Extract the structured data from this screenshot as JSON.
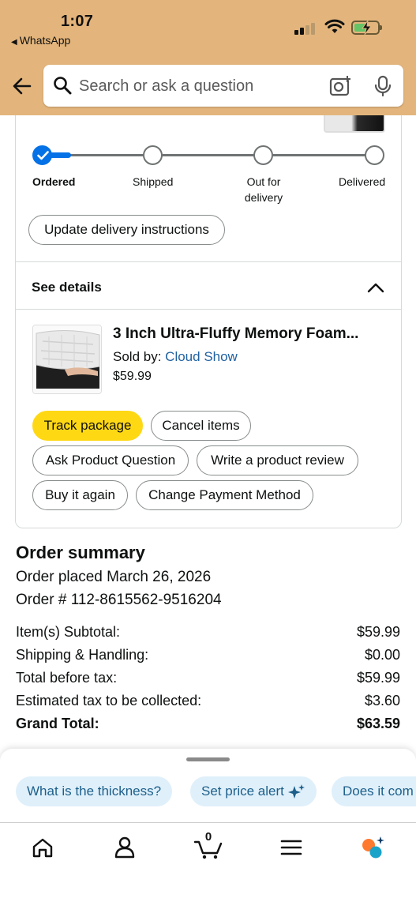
{
  "status_bar": {
    "time": "1:07",
    "back_app": "WhatsApp"
  },
  "search": {
    "placeholder": "Search or ask a question"
  },
  "tracking": {
    "steps": [
      {
        "label": "Ordered",
        "done": true
      },
      {
        "label": "Shipped",
        "done": false
      },
      {
        "label": "Out for delivery",
        "done": false
      },
      {
        "label": "Delivered",
        "done": false
      }
    ],
    "progress": 0.04,
    "update_instructions_label": "Update delivery instructions"
  },
  "details": {
    "see_details_label": "See details",
    "product": {
      "title": "3 Inch Ultra-Fluffy Memory Foam...",
      "sold_by_label": "Sold by:",
      "seller": "Cloud Show",
      "price": "$59.99"
    },
    "actions": {
      "track_package": "Track package",
      "cancel_items": "Cancel items",
      "ask_question": "Ask Product Question",
      "write_review": "Write a product review",
      "buy_again": "Buy it again",
      "change_payment": "Change Payment Method"
    }
  },
  "order_summary": {
    "title": "Order summary",
    "placed": "Order placed March 26, 2026",
    "order_number": "Order # 112-8615562-9516204",
    "rows": [
      {
        "label": "Item(s) Subtotal:",
        "value": "$59.99"
      },
      {
        "label": "Shipping & Handling:",
        "value": "$0.00"
      },
      {
        "label": "Total before tax:",
        "value": "$59.99"
      },
      {
        "label": "Estimated tax to be collected:",
        "value": "$3.60"
      },
      {
        "label": "Grand Total:",
        "value": "$63.59"
      }
    ]
  },
  "assistant_chips": [
    "What is the thickness?",
    "Set price alert",
    "Does it com"
  ],
  "bottom_nav": {
    "cart_count": "0",
    "items": [
      "home-icon",
      "account-icon",
      "cart-icon",
      "menu-icon",
      "rufus-icon"
    ]
  },
  "colors": {
    "header_bg": "#e3b57c",
    "accent_blue": "#0571e6",
    "link_blue": "#2162a1",
    "button_yellow": "#ffd814",
    "chip_bg": "#dff0fb"
  }
}
